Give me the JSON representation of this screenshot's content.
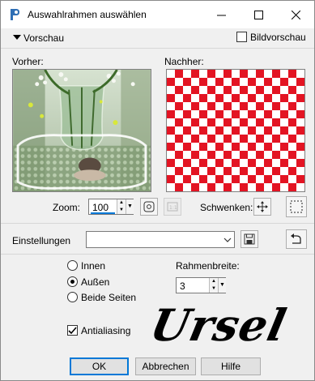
{
  "window": {
    "title": "Auswahlrahmen auswählen"
  },
  "preview": {
    "toggle_label": "Vorschau",
    "image_preview_label": "Bildvorschau",
    "image_preview_checked": false,
    "before_label": "Vorher:",
    "after_label": "Nachher:"
  },
  "zoom": {
    "label": "Zoom:",
    "value": "100",
    "pan_label": "Schwenken:"
  },
  "settings": {
    "label": "Einstellungen",
    "value": ""
  },
  "options": {
    "inner_label": "Innen",
    "outer_label": "Außen",
    "both_label": "Beide Seiten",
    "selected": "outer",
    "frame_width_label": "Rahmenbreite:",
    "frame_width_value": "3",
    "antialias_label": "Antialiasing",
    "antialias_checked": true
  },
  "watermark": {
    "text": "Ursel"
  },
  "buttons": {
    "ok": "OK",
    "cancel": "Abbrechen",
    "help": "Hilfe"
  },
  "colors": {
    "checker_red": "#e31423",
    "accent": "#0078d7"
  }
}
